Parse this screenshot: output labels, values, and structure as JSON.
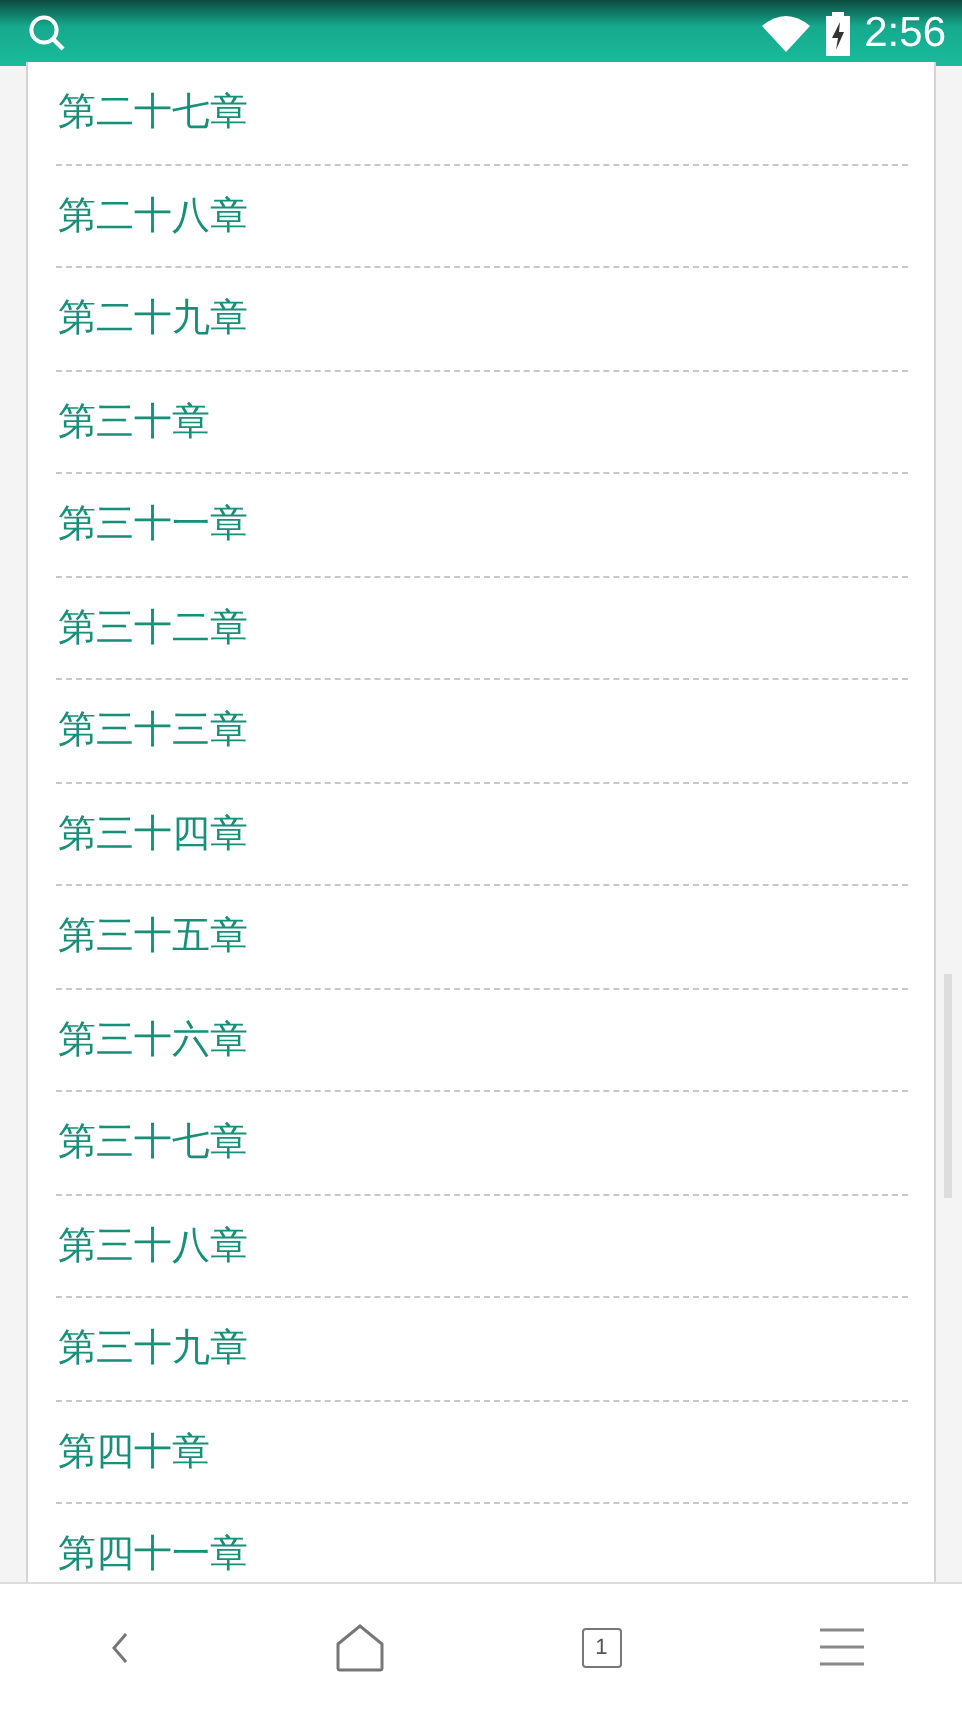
{
  "status_bar": {
    "time": "2:56"
  },
  "chapters": [
    {
      "title": "第二十七章"
    },
    {
      "title": "第二十八章"
    },
    {
      "title": "第二十九章"
    },
    {
      "title": "第三十章"
    },
    {
      "title": "第三十一章"
    },
    {
      "title": "第三十二章"
    },
    {
      "title": "第三十三章"
    },
    {
      "title": "第三十四章"
    },
    {
      "title": "第三十五章"
    },
    {
      "title": "第三十六章"
    },
    {
      "title": "第三十七章"
    },
    {
      "title": "第三十八章"
    },
    {
      "title": "第三十九章"
    },
    {
      "title": "第四十章"
    },
    {
      "title": "第四十一章"
    }
  ],
  "bottom_bar": {
    "tab_count": "1"
  }
}
